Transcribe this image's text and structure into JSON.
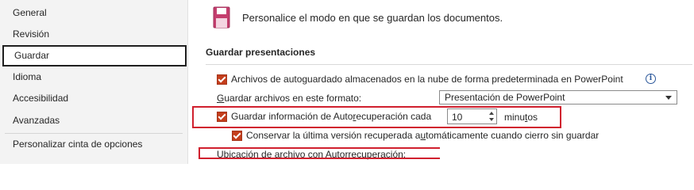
{
  "sidebar": {
    "items": [
      {
        "label": "General"
      },
      {
        "label": "Revisión"
      },
      {
        "label": "Guardar"
      },
      {
        "label": "Idioma"
      },
      {
        "label": "Accesibilidad"
      },
      {
        "label": "Avanzadas"
      },
      {
        "label": "Personalizar cinta de opciones"
      }
    ],
    "selected": "Guardar"
  },
  "header": {
    "icon": "save-icon",
    "text": "Personalice el modo en que se guardan los documentos."
  },
  "section": {
    "title": "Guardar presentaciones"
  },
  "options": {
    "cloud_autosave": {
      "label": "Archivos de autoguardado almacenados en la nube de forma predeterminada en PowerPoint",
      "checked": true,
      "icon": "info-icon"
    },
    "format": {
      "label_pre": "",
      "label_mnemonic": "G",
      "label_post": "uardar archivos en este formato:",
      "value": "Presentación de PowerPoint"
    },
    "autorecover": {
      "label_pre": "Guardar información de Auto",
      "label_mnemonic": "r",
      "label_post": "ecuperación cada",
      "checked": true,
      "minutes_value": "10",
      "minutes_pre": "minu",
      "minutes_mnemonic": "t",
      "minutes_post": "os"
    },
    "keep_last": {
      "label_pre": "Conservar la última versión recuperada a",
      "label_mnemonic": "u",
      "label_post": "tomáticamente cuando cierro sin guardar",
      "checked": true
    },
    "location": {
      "label_pre": "",
      "label_mnemonic": "U",
      "label_post": "bicación de archivo con Autorrecuperación:"
    }
  },
  "colors": {
    "accent": "#c43e1c",
    "highlight": "#d0202e",
    "selected_border": "#1f1f1f"
  }
}
